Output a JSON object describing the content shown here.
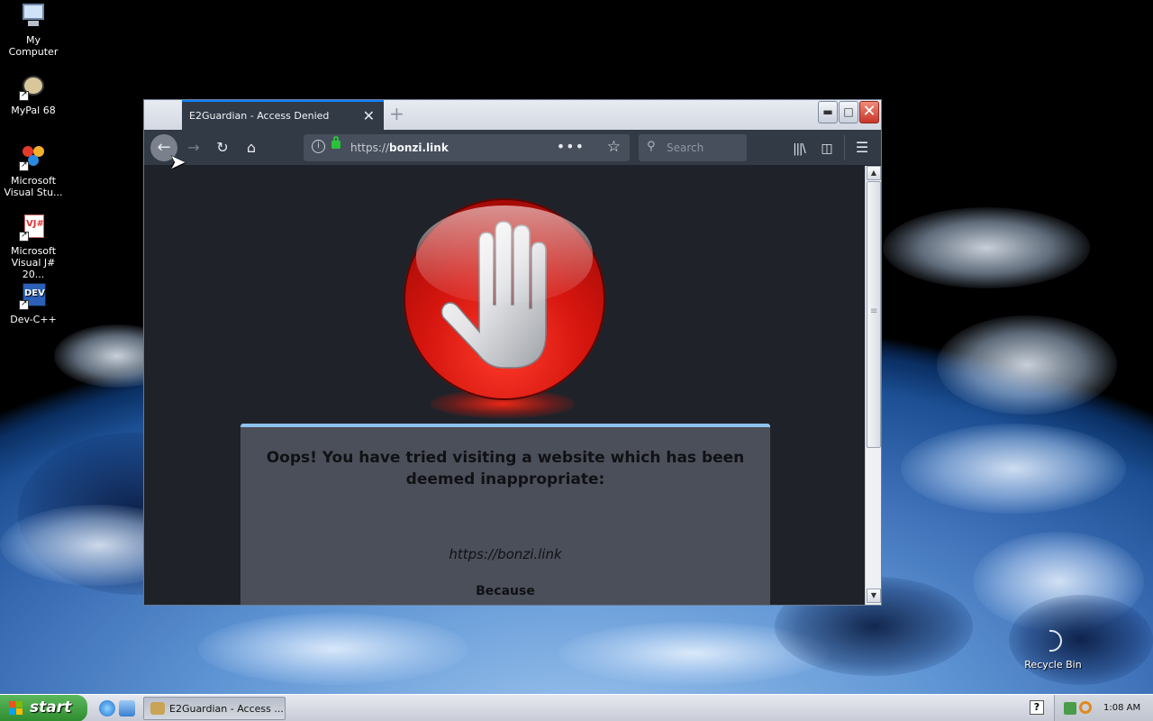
{
  "desktop": {
    "icons": [
      {
        "label": "My Computer"
      },
      {
        "label": "MyPal 68"
      },
      {
        "label": "Microsoft Visual Stu..."
      },
      {
        "label": "Microsoft Visual J# 20..."
      },
      {
        "label": "Dev-C++"
      },
      {
        "label": "Recycle Bin"
      }
    ]
  },
  "browser": {
    "tab_title": "E2Guardian - Access Denied",
    "tab_close": "✕",
    "new_tab": "+",
    "url_prefix": "https://",
    "url_domain": "bonzi.link",
    "search_placeholder": "Search",
    "page": {
      "heading": "Oops! You have tried visiting a website which has been deemed inappropriate:",
      "blocked_url": "https://bonzi.link",
      "because_label": "Because"
    }
  },
  "taskbar": {
    "start_label": "start",
    "task_label": "E2Guardian - Access ...",
    "help_glyph": "?",
    "clock": "1:08 AM"
  },
  "colors": {
    "browser_chrome": "#323a46",
    "content_bg": "#1f2329",
    "card_bg": "#4b4f5a",
    "card_accent": "#8ec3f0",
    "stop_red": "#d4150e",
    "secure_lock": "#2ac33a"
  }
}
